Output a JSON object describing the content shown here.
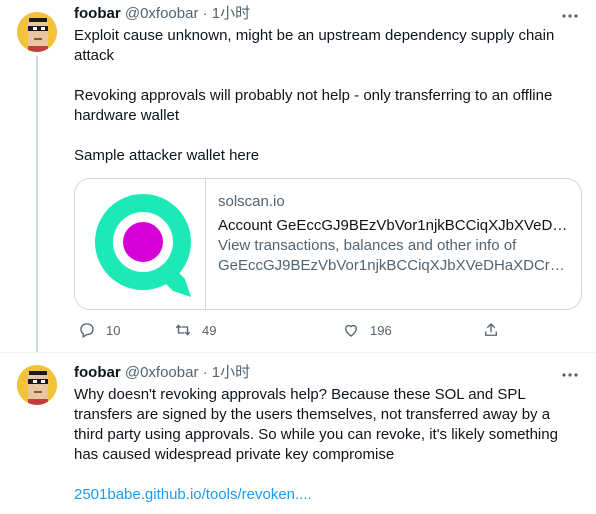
{
  "tweets": [
    {
      "name": "foobar",
      "handle": "@0xfoobar",
      "separator": "·",
      "time": "1小时",
      "lines": [
        "Exploit cause unknown, might be an upstream dependency supply chain attack",
        "Revoking approvals will probably not help - only transferring to an offline hardware wallet",
        "Sample attacker wallet here"
      ],
      "card": {
        "domain": "solscan.io",
        "title": "Account GeEccGJ9BEzVbVor1njkBCCiqXJbXVeDH...",
        "description": "View transactions, balances and other info of GeEccGJ9BEzVbVor1njkBCCiqXJbXVeDHaXDCrB..."
      },
      "actions": {
        "replies": "10",
        "retweets": "49",
        "likes": "196"
      }
    },
    {
      "name": "foobar",
      "handle": "@0xfoobar",
      "separator": "·",
      "time": "1小时",
      "text": "Why doesn't revoking approvals help? Because these SOL and SPL transfers are signed by the users themselves, not transferred away by a third party using approvals. So while you can revoke, it's likely something has caused widespread private key compromise",
      "link": "2501babe.github.io/tools/revoken...."
    }
  ],
  "colors": {
    "accent": "#1d9bf0",
    "muted": "#536471",
    "avatar_bg": "#f2c33a",
    "logo_ring": "#1de9b6",
    "logo_center": "#d500d8"
  },
  "icons": [
    "avatar-pixel-punk",
    "more-icon",
    "reply-icon",
    "retweet-icon",
    "like-icon",
    "share-icon"
  ]
}
